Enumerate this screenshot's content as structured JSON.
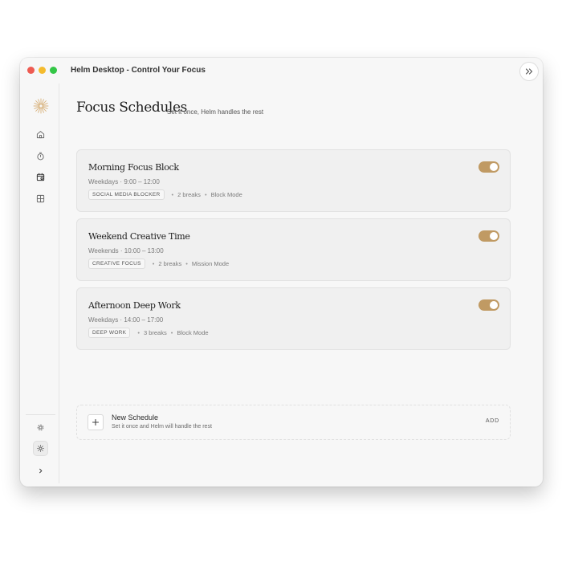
{
  "window": {
    "title": "Helm Desktop - Control Your Focus"
  },
  "page": {
    "title": "Focus Schedules",
    "subtitle": "Set it once, Helm handles the rest"
  },
  "schedules": [
    {
      "name": "Morning Focus Block",
      "time": "Weekdays · 9:00 – 12:00",
      "tag": "SOCIAL MEDIA BLOCKER",
      "breaks": "2 breaks",
      "mode": "Block Mode",
      "enabled": true
    },
    {
      "name": "Weekend Creative Time",
      "time": "Weekends · 10:00 – 13:00",
      "tag": "CREATIVE FOCUS",
      "breaks": "2 breaks",
      "mode": "Mission Mode",
      "enabled": true
    },
    {
      "name": "Afternoon Deep Work",
      "time": "Weekdays · 14:00 – 17:00",
      "tag": "DEEP WORK",
      "breaks": "3 breaks",
      "mode": "Block Mode",
      "enabled": true
    }
  ],
  "new_schedule": {
    "title": "New Schedule",
    "subtitle": "Set it once and Helm will handle the rest",
    "action": "ADD"
  },
  "icons": {
    "logo": "sun-logo-icon",
    "nav": [
      "home-icon",
      "timer-icon",
      "calendar-icon",
      "grid-icon"
    ],
    "bottom": [
      "gear-icon",
      "theme-sun-icon",
      "chevron-right-icon"
    ],
    "window_action": "double-chevron-right-icon"
  },
  "colors": {
    "accent": "#c09a63",
    "logo": "#d8b27c"
  }
}
